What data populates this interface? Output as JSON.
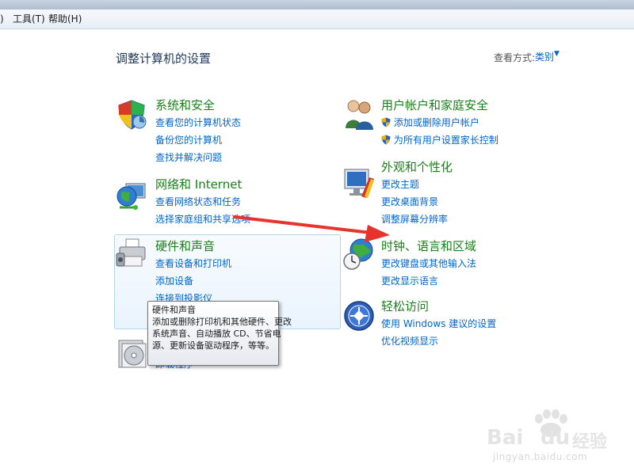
{
  "menu": {
    "first": ")",
    "tools": "工具(T)",
    "help": "帮助(H)"
  },
  "page_title": "调整计算机的设置",
  "view": {
    "label": "查看方式:",
    "value": "类别"
  },
  "categories": {
    "system": {
      "title": "系统和安全",
      "links": [
        "查看您的计算机状态",
        "备份您的计算机",
        "查找并解决问题"
      ]
    },
    "network": {
      "title": "网络和 Internet",
      "links": [
        "查看网络状态和任务",
        "选择家庭组和共享选项"
      ]
    },
    "hardware": {
      "title": "硬件和声音",
      "links": [
        "查看设备和打印机",
        "添加设备",
        "连接到投影仪"
      ]
    },
    "programs": {
      "partial_link": "卸载程序"
    },
    "users": {
      "title": "用户帐户和家庭安全",
      "links": [
        "添加或删除用户帐户",
        "为所有用户设置家长控制"
      ]
    },
    "appearance": {
      "title": "外观和个性化",
      "links": [
        "更改主题",
        "更改桌面背景",
        "调整屏幕分辨率"
      ]
    },
    "clock": {
      "title": "时钟、语言和区域",
      "links": [
        "更改键盘或其他输入法",
        "更改显示语言"
      ]
    },
    "ease": {
      "title": "轻松访问",
      "links": [
        "使用 Windows 建议的设置",
        "优化视频显示"
      ]
    }
  },
  "tooltip": {
    "title": "硬件和声音",
    "lines": [
      "添加或删除打印机和其他硬件、更改",
      "系统声音、自动播放 CD、节省电",
      "源、更新设备驱动程序，等等。"
    ]
  },
  "watermark": {
    "brand_left": "Bai",
    "brand_right": "du",
    "brand_cn": "经验",
    "url": "jingyan.baidu.com"
  },
  "colors": {
    "link": "#0066cc",
    "category_title": "#1a7f1a",
    "arrow": "#e8322e"
  }
}
